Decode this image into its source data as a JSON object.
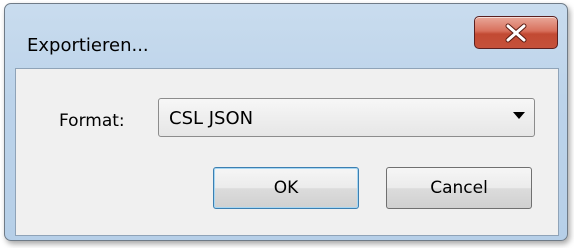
{
  "dialog": {
    "title": "Exportieren...",
    "close_icon": "close-icon"
  },
  "form": {
    "format_label": "Format:",
    "format_value": "CSL JSON",
    "dropdown_icon": "chevron-down-icon"
  },
  "buttons": {
    "ok_label": "OK",
    "cancel_label": "Cancel"
  },
  "colors": {
    "titlebar": "#bcd3ea",
    "close_button": "#c24a33",
    "client": "#f0f0f0",
    "ok_border": "#3c7fb1"
  }
}
